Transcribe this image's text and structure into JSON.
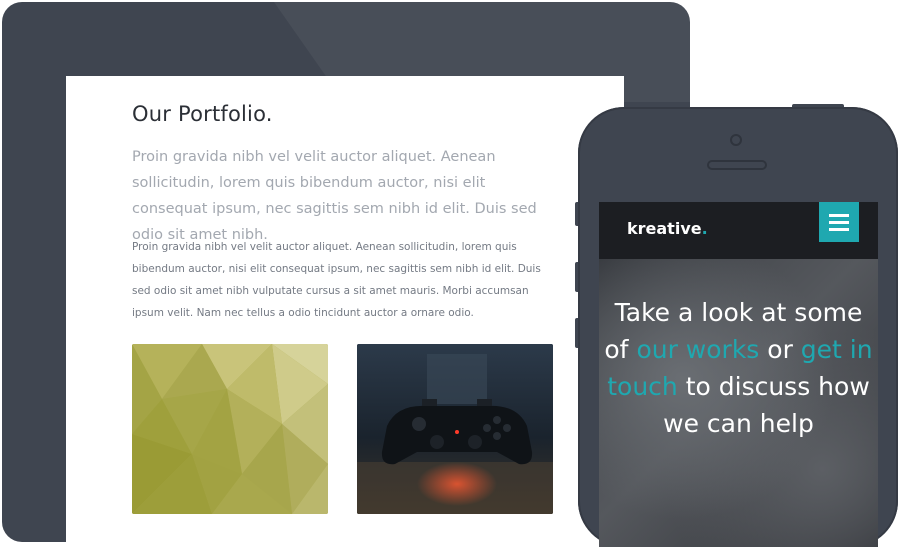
{
  "colors": {
    "device_frame": "#3f4550",
    "accent": "#1fa8b0",
    "heading": "#2b2f36",
    "lead_text": "#a3a8b0",
    "body_text": "#747a84"
  },
  "tablet": {
    "title": "Our Portfolio.",
    "lead": "Proin gravida nibh vel velit auctor aliquet. Aenean sollicitudin, lorem quis bibendum auctor, nisi elit consequat ipsum, nec sagittis sem nibh id elit. Duis sed odio sit amet nibh.",
    "body": "Proin gravida nibh vel velit auctor aliquet. Aenean sollicitudin, lorem quis bibendum auctor, nisi elit consequat ipsum, nec sagittis sem nibh id elit. Duis sed odio sit amet nibh vulputate cursus a sit amet mauris. Morbi accumsan ipsum velit. Nam nec tellus a odio tincidunt auctor a ornare odio.",
    "thumbnails": [
      {
        "name": "portfolio-thumb-polygon",
        "icon": "low-poly-pattern"
      },
      {
        "name": "portfolio-thumb-gamepad",
        "icon": "gamepad-photo"
      }
    ]
  },
  "phone": {
    "logo_text": "kreative",
    "logo_dot": ".",
    "menu_icon": "hamburger-menu-icon",
    "hero": {
      "t1": "Take a look at some of ",
      "link1": "our works",
      "t2": " or ",
      "link2": "get in touch",
      "t3": " to discuss how we can help"
    }
  }
}
